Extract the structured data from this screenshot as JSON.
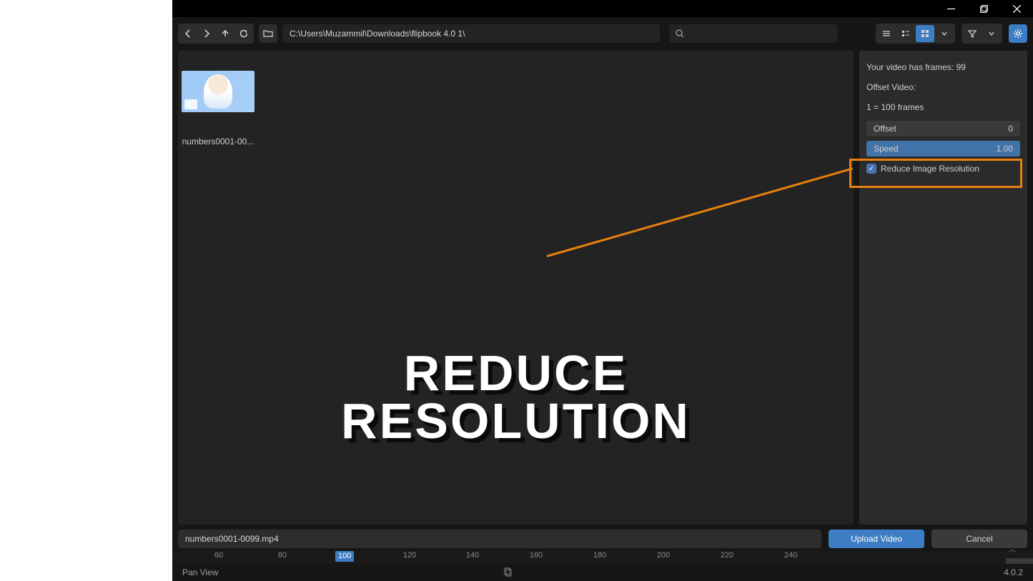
{
  "toolbar": {
    "path": "C:\\Users\\Muzammil\\Downloads\\flipbook 4.0 1\\"
  },
  "thumbnail": {
    "label": "numbers0001-00..."
  },
  "panel": {
    "frames_text": "Your video has frames: 99",
    "offset_title": "Offset Video:",
    "hint": "1 = 100 frames",
    "offset_label": "Offset",
    "offset_value": "0",
    "speed_label": "Speed",
    "speed_value": "1.00",
    "reduce_label": "Reduce Image Resolution"
  },
  "overlay": {
    "line1": "REDUCE",
    "line2": "RESOLUTION"
  },
  "footer": {
    "filename": "numbers0001-0099.mp4",
    "upload": "Upload Video",
    "cancel": "Cancel"
  },
  "timeline": {
    "ticks": [
      "60",
      "80",
      "100",
      "120",
      "140",
      "160",
      "180",
      "200",
      "220",
      "240"
    ],
    "marker": "100"
  },
  "statusbar": {
    "hint": "Pan View",
    "version": "4.0.2"
  }
}
